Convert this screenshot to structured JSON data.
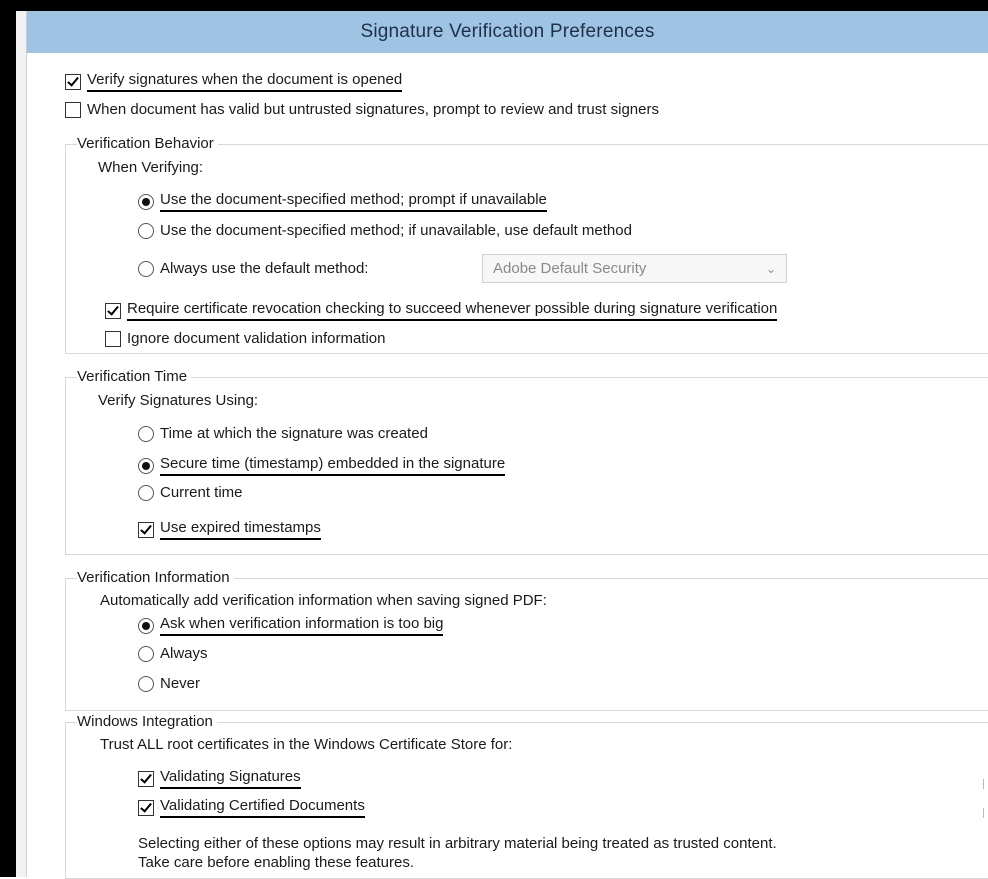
{
  "title": "Signature Verification Preferences",
  "top_options": [
    {
      "label": "Verify signatures when the document is opened",
      "checked": true
    },
    {
      "label": "When document has valid but untrusted signatures, prompt to review and trust signers",
      "checked": false
    }
  ],
  "behavior": {
    "title": "Verification Behavior",
    "subtitle": "When Verifying:",
    "radios": [
      {
        "label": "Use the document-specified method; prompt if unavailable",
        "selected": true
      },
      {
        "label": "Use the document-specified method; if unavailable, use default method",
        "selected": false
      },
      {
        "label": "Always use the default method:",
        "selected": false
      }
    ],
    "default_method_value": "Adobe Default Security",
    "checkboxes": [
      {
        "label": "Require certificate revocation checking to succeed whenever possible during signature verification",
        "checked": true
      },
      {
        "label": "Ignore document validation information",
        "checked": false
      }
    ]
  },
  "time": {
    "title": "Verification Time",
    "subtitle": "Verify Signatures Using:",
    "radios": [
      {
        "label": "Time at which the signature was created",
        "selected": false
      },
      {
        "label": "Secure time (timestamp) embedded in the signature",
        "selected": true
      },
      {
        "label": "Current time",
        "selected": false
      }
    ],
    "expired": {
      "label": "Use expired timestamps",
      "checked": true
    }
  },
  "info": {
    "title": "Verification Information",
    "subtitle": "Automatically add verification information when saving signed PDF:",
    "radios": [
      {
        "label": "Ask when verification information is too big",
        "selected": true
      },
      {
        "label": "Always",
        "selected": false
      },
      {
        "label": "Never",
        "selected": false
      }
    ]
  },
  "windows": {
    "title": "Windows Integration",
    "subtitle": "Trust ALL root certificates in the Windows Certificate Store for:",
    "checkboxes": [
      {
        "label": "Validating Signatures",
        "checked": true
      },
      {
        "label": "Validating Certified Documents",
        "checked": true
      }
    ],
    "note_line1": "Selecting either of these options may result in arbitrary material being treated as trusted content.",
    "note_line2": "Take care before enabling these features."
  },
  "colors": {
    "titlebar": "#9fc4e3",
    "frame": "#000000"
  }
}
